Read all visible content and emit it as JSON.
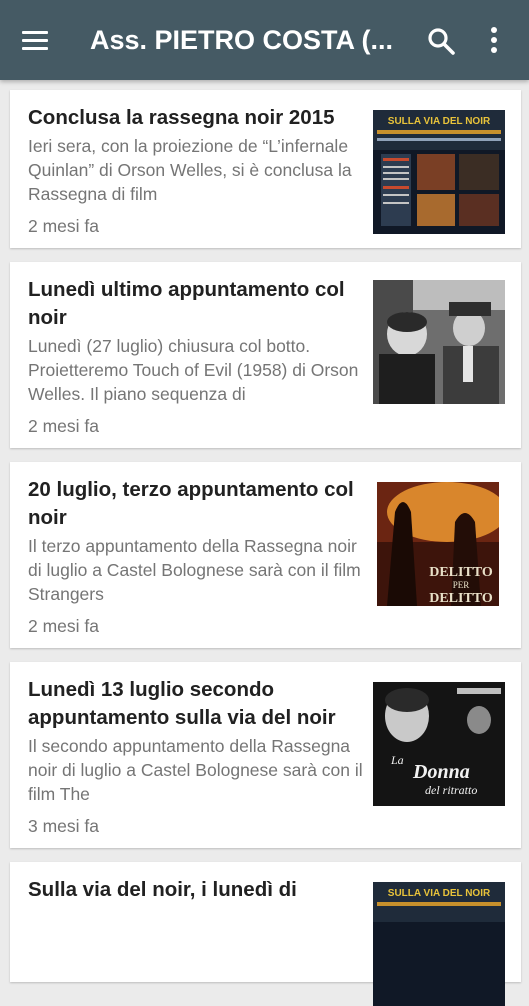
{
  "appbar": {
    "title": "Ass. PIETRO COSTA (...",
    "menu_icon": "menu-icon",
    "search_icon": "search-icon",
    "more_icon": "more-vert-icon",
    "background": "#455a64"
  },
  "articles": [
    {
      "title": "Conclusa la rassegna noir 2015",
      "excerpt": "Ieri sera, con la proiezione de “L’infernale Quinlan” di Orson Welles, si è conclusa la Rassegna di film",
      "time": "2 mesi fa",
      "thumb": "noir-poster-thumbnail"
    },
    {
      "title": "Lunedì ultimo appuntamento col noir",
      "excerpt": "Lunedì (27 luglio) chiusura col botto. Proietteremo Touch of Evil (1958) di Orson Welles. Il piano sequenza di",
      "time": "2 mesi fa",
      "thumb": "film-still-thumbnail"
    },
    {
      "title": "20 luglio, terzo appuntamento col noir",
      "excerpt": "Il terzo appuntamento della Rassegna noir di luglio a Castel Bolognese sarà con il film Strangers",
      "time": "2 mesi fa",
      "thumb": "delitto-per-delitto-poster-thumbnail"
    },
    {
      "title": "Lunedì 13 luglio secondo appuntamento sulla via del noir",
      "excerpt": "Il secondo appuntamento della Rassegna noir di luglio a Castel Bolognese sarà con il film The",
      "time": "3 mesi fa",
      "thumb": "donna-del-ritratto-poster-thumbnail"
    },
    {
      "title": "Sulla via del noir, i lunedì di",
      "excerpt": "",
      "time": "",
      "thumb": "noir-poster-thumbnail"
    }
  ],
  "thumb_text": {
    "noir_title": "SULLA VIA DEL NOIR",
    "delitto_line1": "DELITTO",
    "delitto_line2": "PER",
    "delitto_line3": "DELITTO",
    "donna_line1": "La",
    "donna_line2": "Donna",
    "donna_line3": "del ritratto"
  }
}
